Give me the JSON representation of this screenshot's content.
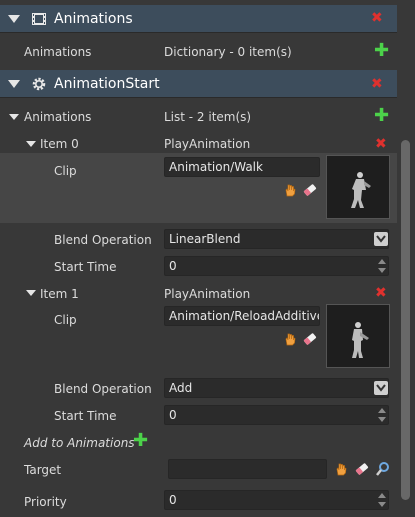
{
  "sections": [
    {
      "title": "Animations"
    },
    {
      "title": "AnimationStart"
    }
  ],
  "animations_row": {
    "label": "Animations",
    "value": "Dictionary - 0 item(s)"
  },
  "start_animations": {
    "label": "Animations",
    "value": "List - 2 item(s)"
  },
  "items": [
    {
      "label": "Item 0",
      "type": "PlayAnimation",
      "clip_label": "Clip",
      "clip_value": "Animation/Walk",
      "blend_label": "Blend Operation",
      "blend_value": "LinearBlend",
      "start_label": "Start Time",
      "start_value": "0"
    },
    {
      "label": "Item 1",
      "type": "PlayAnimation",
      "clip_label": "Clip",
      "clip_value": "Animation/ReloadAdditive",
      "blend_label": "Blend Operation",
      "blend_value": "Add",
      "start_label": "Start Time",
      "start_value": "0"
    }
  ],
  "add_to_animations": "Add to Animations",
  "target": {
    "label": "Target",
    "value": ""
  },
  "priority": {
    "label": "Priority",
    "value": "0"
  },
  "colors": {
    "header": "#3d4d5c",
    "remove": "#e0312e",
    "add": "#4cd24a",
    "panel": "#383838"
  }
}
